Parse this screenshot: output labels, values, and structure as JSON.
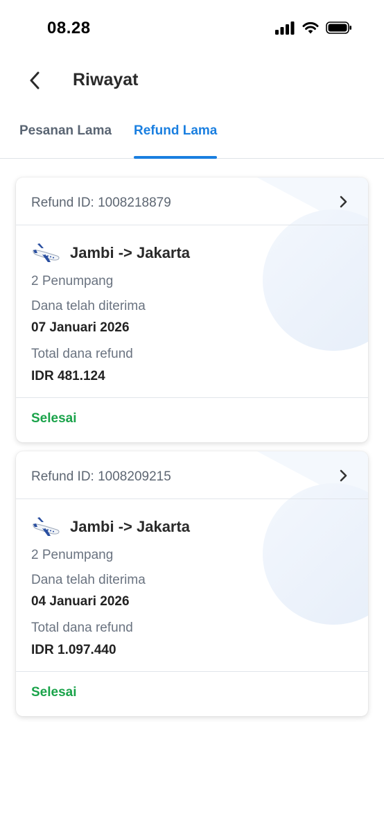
{
  "status_bar": {
    "time": "08.28"
  },
  "header": {
    "title": "Riwayat"
  },
  "tabs": [
    {
      "label": "Pesanan Lama",
      "active": false
    },
    {
      "label": "Refund Lama",
      "active": true
    }
  ],
  "colors": {
    "accent": "#1a7fe0",
    "success": "#1aa34a"
  },
  "refunds": [
    {
      "refund_id": "Refund ID: 1008218879",
      "route": "Jambi -> Jakarta",
      "passengers": "2 Penumpang",
      "received_label": "Dana telah diterima",
      "received_date": "07 Januari 2026",
      "total_label": "Total dana refund",
      "total_amount": "IDR 481.124",
      "status": "Selesai"
    },
    {
      "refund_id": "Refund ID: 1008209215",
      "route": "Jambi -> Jakarta",
      "passengers": "2 Penumpang",
      "received_label": "Dana telah diterima",
      "received_date": "04 Januari 2026",
      "total_label": "Total dana refund",
      "total_amount": "IDR 1.097.440",
      "status": "Selesai"
    }
  ]
}
